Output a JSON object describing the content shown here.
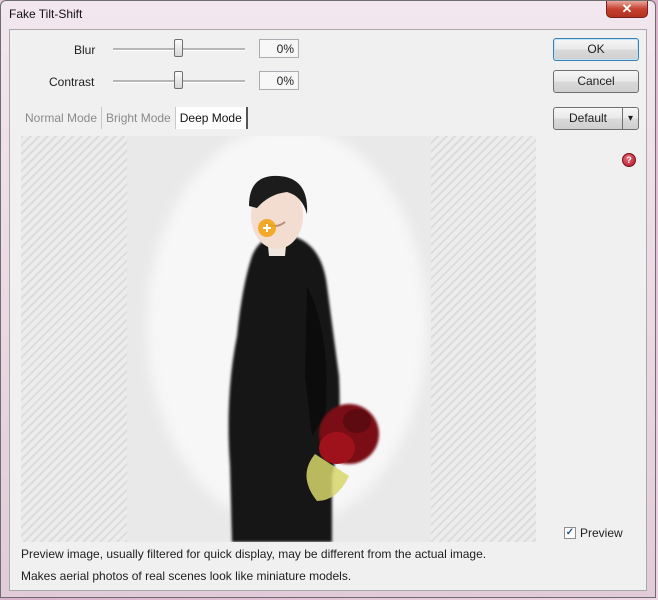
{
  "window": {
    "title": "Fake Tilt-Shift",
    "close_glyph": "✕"
  },
  "controls": {
    "blur": {
      "label": "Blur",
      "value": "0%",
      "level": 0.5
    },
    "contrast": {
      "label": "Contrast",
      "value": "0%",
      "level": 0.5
    }
  },
  "buttons": {
    "ok": "OK",
    "cancel": "Cancel",
    "preset": "Default",
    "preset_arrow": "▾"
  },
  "modes": [
    {
      "label": "Normal Mode",
      "active": false
    },
    {
      "label": "Bright Mode",
      "active": false
    },
    {
      "label": "Deep Mode",
      "active": true
    }
  ],
  "help": {
    "glyph": "?",
    "icon": "help-icon",
    "color": "#b01227"
  },
  "preview_toggle": {
    "label": "Preview",
    "checked": true,
    "mark": "✓"
  },
  "notes": {
    "line1": "Preview image, usually filtered for quick display, may be different from the actual image.",
    "line2": "Makes aerial photos of real scenes look like miniature models."
  }
}
